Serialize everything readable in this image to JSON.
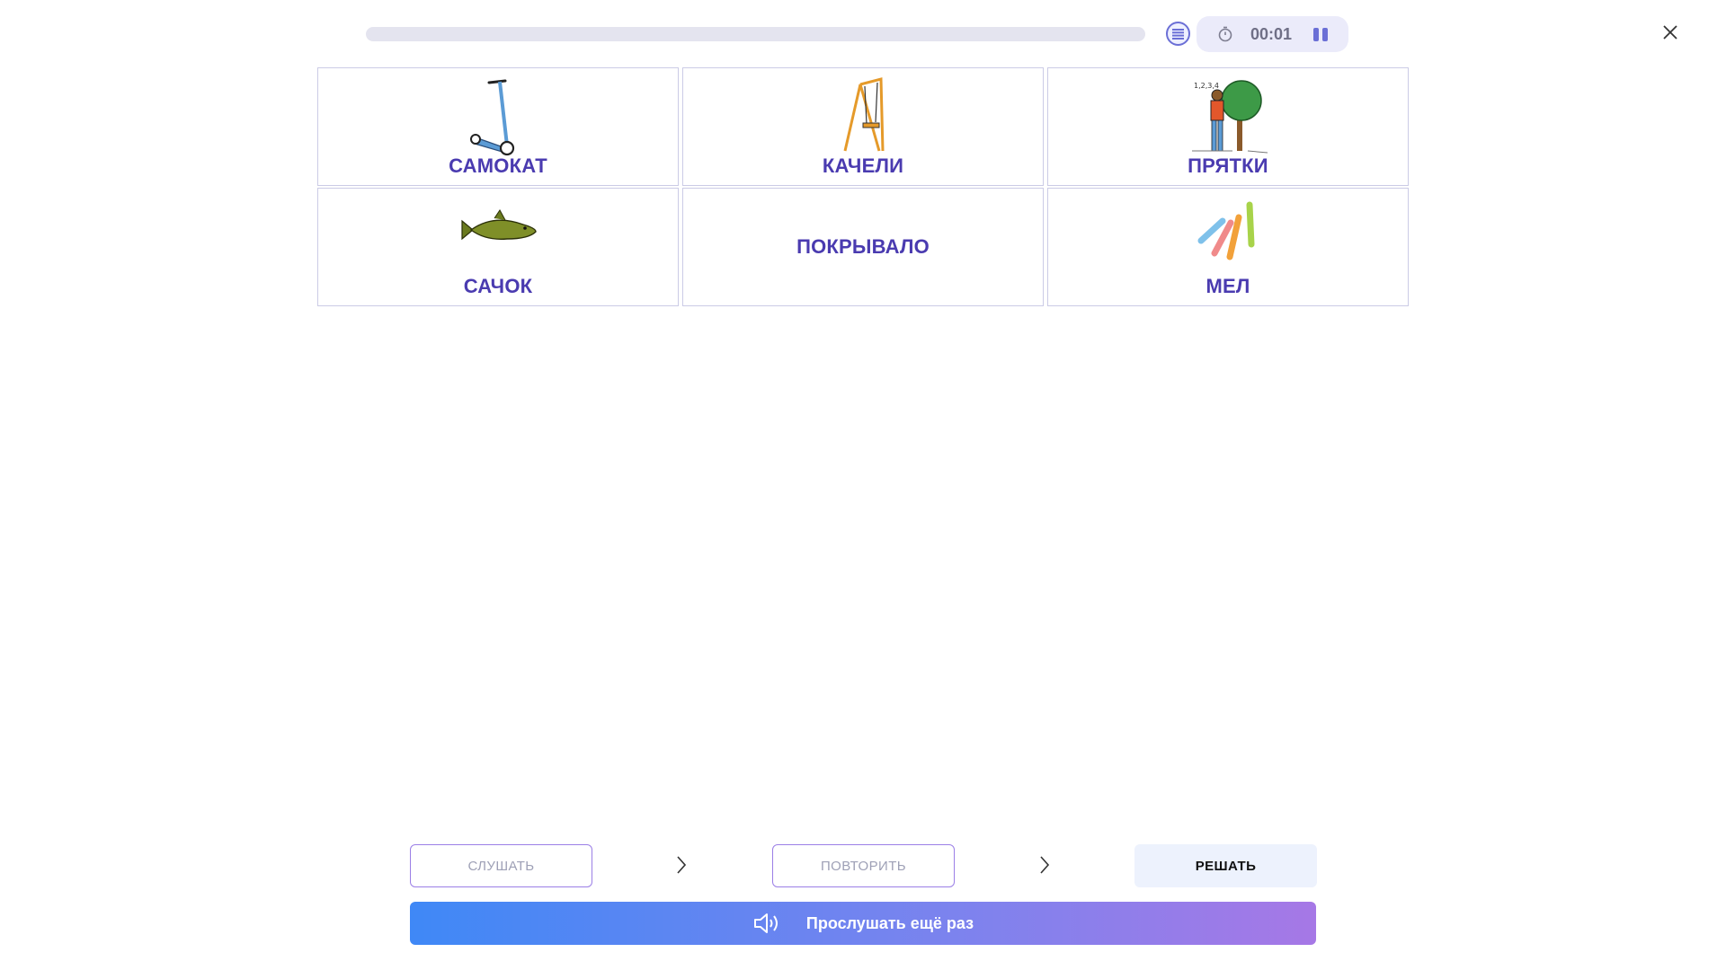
{
  "header": {
    "progress_percent": 0,
    "timer": "00:01"
  },
  "cards": [
    {
      "label": "САМОКАТ",
      "icon": "scooter-icon"
    },
    {
      "label": "КАЧЕЛИ",
      "icon": "swing-icon"
    },
    {
      "label": "ПРЯТКИ",
      "icon": "hide-and-seek-icon"
    },
    {
      "label": "САЧОК",
      "icon": "fish-icon"
    },
    {
      "label": "ПОКРЫВАЛО",
      "icon": ""
    },
    {
      "label": "МЕЛ",
      "icon": "chalk-icon"
    }
  ],
  "steps": {
    "listen": "СЛУШАТЬ",
    "repeat": "ПОВТОРИТЬ",
    "solve": "РЕШАТЬ"
  },
  "listen_again_label": "Прослушать ещё раз",
  "colors": {
    "label": "#4a3bb0",
    "accent": "#6b6fd6",
    "gradient_start": "#3f88f6",
    "gradient_end": "#a678e6"
  }
}
